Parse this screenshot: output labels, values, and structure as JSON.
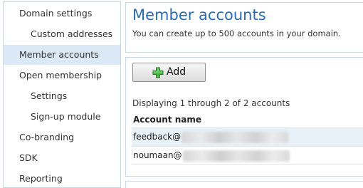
{
  "sidebar": {
    "items": [
      {
        "label": "Domain settings",
        "level": "top",
        "selected": false
      },
      {
        "label": "Custom addresses",
        "level": "sub",
        "selected": false
      },
      {
        "label": "Member accounts",
        "level": "top",
        "selected": true
      },
      {
        "label": "Open membership",
        "level": "top",
        "selected": false
      },
      {
        "label": "Settings",
        "level": "sub",
        "selected": false
      },
      {
        "label": "Sign-up module",
        "level": "sub",
        "selected": false
      },
      {
        "label": "Co-branding",
        "level": "top",
        "selected": false
      },
      {
        "label": "SDK",
        "level": "top",
        "selected": false
      },
      {
        "label": "Reporting",
        "level": "top",
        "selected": false
      }
    ]
  },
  "header": {
    "title": "Member accounts",
    "subtitle": "You can create up to 500 accounts in your domain."
  },
  "toolbar": {
    "add_label": "Add",
    "add_icon": "plus-icon",
    "add_icon_color": "#3aa63a"
  },
  "accounts": {
    "display_info": "Displaying 1 through 2 of 2 accounts",
    "column_header": "Account name",
    "rows": [
      {
        "name": "feedback@",
        "redacted": true
      },
      {
        "name": "noumaan@",
        "redacted": true
      }
    ]
  },
  "colors": {
    "title": "#2b6cb3",
    "selected_bg": "#dbe8f6",
    "border": "#c9d7e4"
  }
}
